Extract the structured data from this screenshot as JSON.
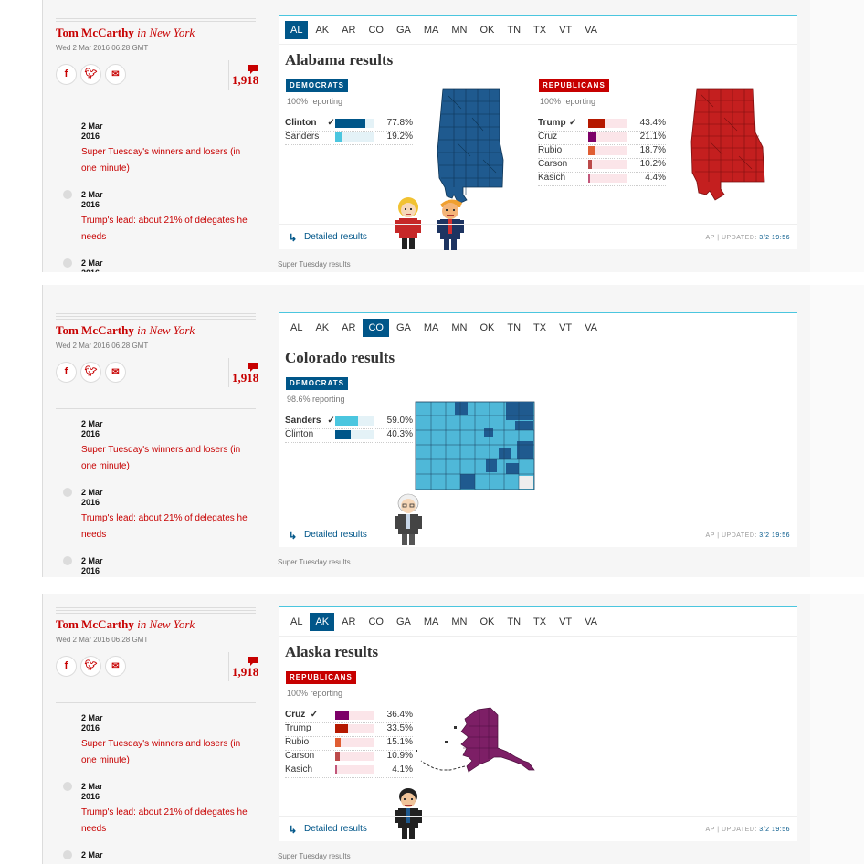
{
  "byline": {
    "author": "Tom McCarthy",
    "location": "in New York",
    "date": "Wed 2 Mar 2016 06.28 GMT"
  },
  "share": {
    "facebook": "f",
    "twitter": "t",
    "email": "✉"
  },
  "comments": {
    "count": "1,918"
  },
  "timeline": [
    {
      "day": "2 Mar",
      "year": "2016",
      "title": "Super Tuesday's winners and losers (in one minute)"
    },
    {
      "day": "2 Mar",
      "year": "2016",
      "title": "Trump's lead: about 21% of delegates he needs"
    },
    {
      "day": "2 Mar",
      "year": "2016"
    }
  ],
  "tabs": [
    "AL",
    "AK",
    "AR",
    "CO",
    "GA",
    "MA",
    "MN",
    "OK",
    "TN",
    "TX",
    "VT",
    "VA"
  ],
  "footer": {
    "detailed": "Detailed results",
    "updated_prefix": "AP | UPDATED:",
    "updated_time": "3/2 19:56",
    "caption": "Super Tuesday results"
  },
  "panels": [
    {
      "active_tab": "AL",
      "title": "Alabama results",
      "groups": [
        {
          "party": "DEMOCRATS",
          "reporting": "100% reporting",
          "candidates": [
            {
              "name": "Clinton",
              "winner": true,
              "pct": "77.8%",
              "value": 77.8,
              "color": "#005689"
            },
            {
              "name": "Sanders",
              "winner": false,
              "pct": "19.2%",
              "value": 19.2,
              "color": "#4bc6df"
            }
          ]
        },
        {
          "party": "REPUBLICANS",
          "reporting": "100% reporting",
          "candidates": [
            {
              "name": "Trump",
              "winner": true,
              "pct": "43.4%",
              "value": 43.4,
              "color": "#b51800"
            },
            {
              "name": "Cruz",
              "winner": false,
              "pct": "21.1%",
              "value": 21.1,
              "color": "#7d0068"
            },
            {
              "name": "Rubio",
              "winner": false,
              "pct": "18.7%",
              "value": 18.7,
              "color": "#e05e33"
            },
            {
              "name": "Carson",
              "winner": false,
              "pct": "10.2%",
              "value": 10.2,
              "color": "#bc4a4a"
            },
            {
              "name": "Kasich",
              "winner": false,
              "pct": "4.4%",
              "value": 4.4,
              "color": "#c2577a"
            }
          ]
        }
      ]
    },
    {
      "active_tab": "CO",
      "title": "Colorado results",
      "groups": [
        {
          "party": "DEMOCRATS",
          "reporting": "98.6% reporting",
          "candidates": [
            {
              "name": "Sanders",
              "winner": true,
              "pct": "59.0%",
              "value": 59.0,
              "color": "#4bc6df"
            },
            {
              "name": "Clinton",
              "winner": false,
              "pct": "40.3%",
              "value": 40.3,
              "color": "#005689"
            }
          ]
        }
      ]
    },
    {
      "active_tab": "AK",
      "title": "Alaska results",
      "groups": [
        {
          "party": "REPUBLICANS",
          "reporting": "100% reporting",
          "candidates": [
            {
              "name": "Cruz",
              "winner": true,
              "pct": "36.4%",
              "value": 36.4,
              "color": "#7d0068"
            },
            {
              "name": "Trump",
              "winner": false,
              "pct": "33.5%",
              "value": 33.5,
              "color": "#b51800"
            },
            {
              "name": "Rubio",
              "winner": false,
              "pct": "15.1%",
              "value": 15.1,
              "color": "#e05e33"
            },
            {
              "name": "Carson",
              "winner": false,
              "pct": "10.9%",
              "value": 10.9,
              "color": "#bc4a4a"
            },
            {
              "name": "Kasich",
              "winner": false,
              "pct": "4.1%",
              "value": 4.1,
              "color": "#c2577a"
            }
          ]
        }
      ]
    }
  ],
  "colors": {
    "guardian_red": "#c70000",
    "guardian_blue": "#005689",
    "light_blue": "#4bc6df",
    "dem_map": "#1f5a8f",
    "rep_map": "#c41f1f",
    "ak_map": "#7d1f66",
    "co_map": "#4fb8d8"
  }
}
